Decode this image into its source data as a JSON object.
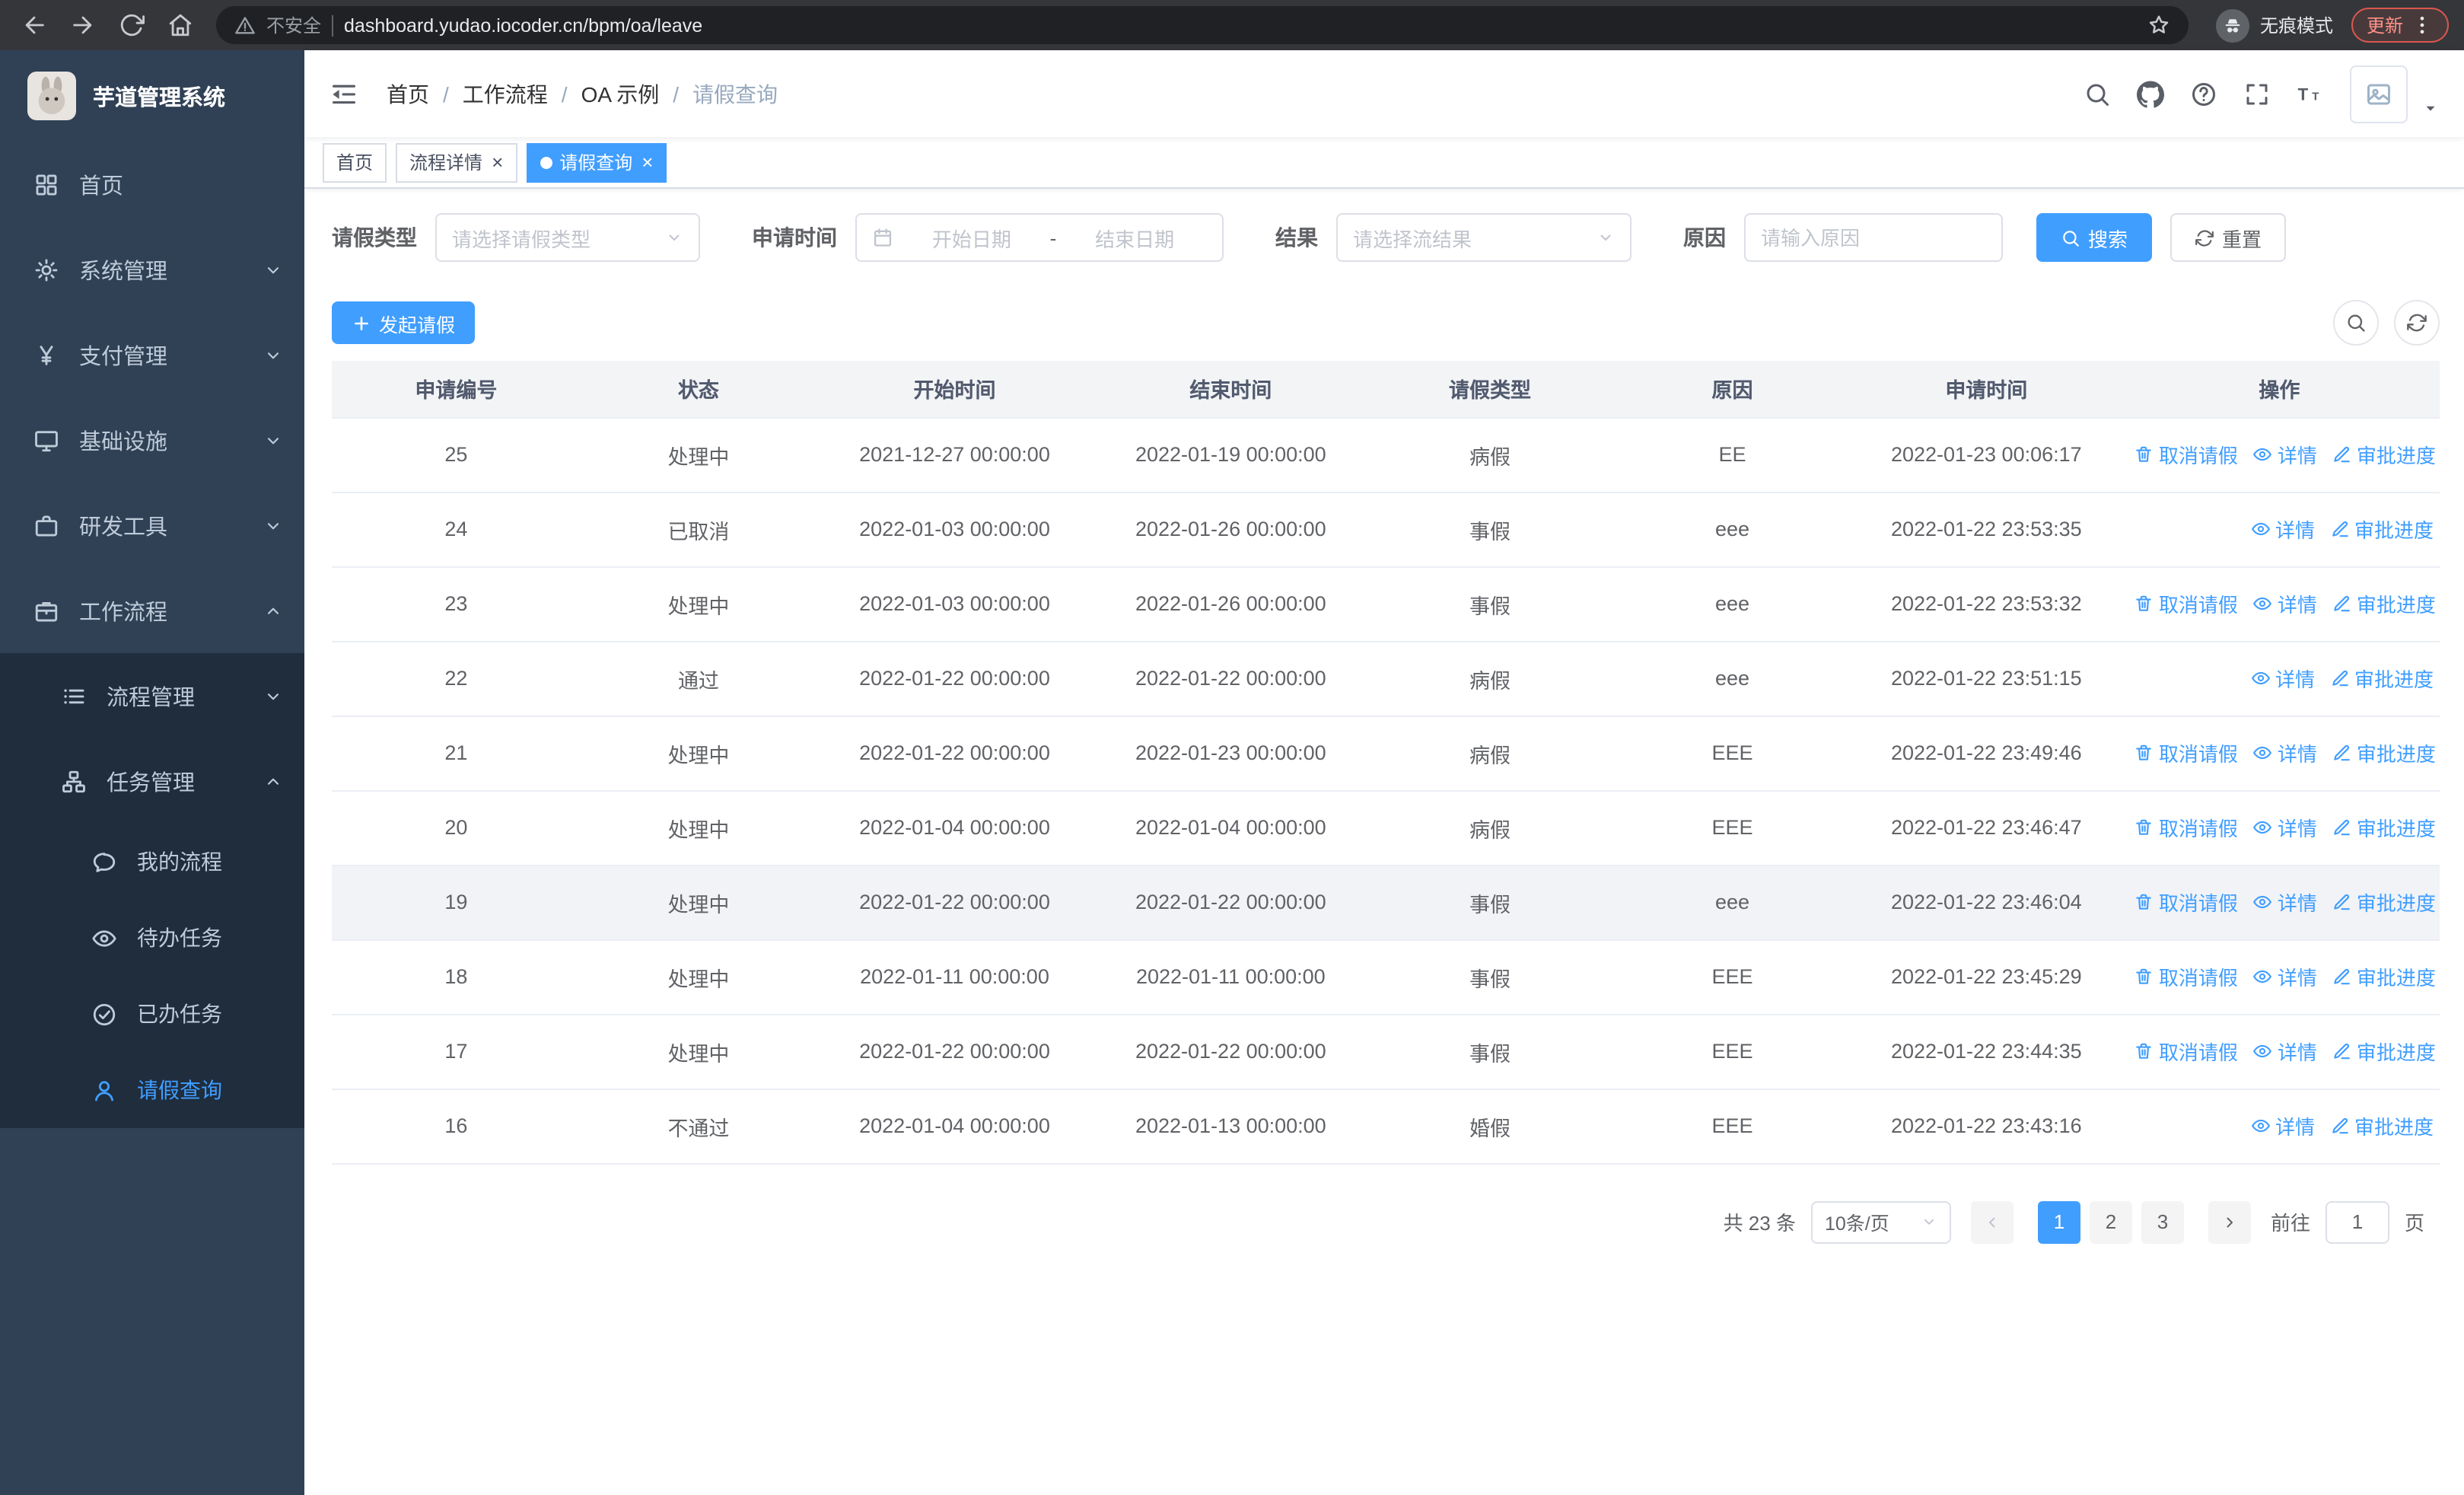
{
  "browser": {
    "security_label": "不安全",
    "url": "dashboard.yudao.iocoder.cn/bpm/oa/leave",
    "incognito_label": "无痕模式",
    "update_label": "更新"
  },
  "sidebar": {
    "logo_title": "芋道管理系统",
    "items": [
      {
        "id": "home",
        "label": "首页",
        "icon": "dashboard",
        "level": 1
      },
      {
        "id": "system-mgmt",
        "label": "系统管理",
        "icon": "gear",
        "level": 1,
        "chevron": "down"
      },
      {
        "id": "payment-mgmt",
        "label": "支付管理",
        "icon": "yen",
        "level": 1,
        "chevron": "down"
      },
      {
        "id": "infrastructure",
        "label": "基础设施",
        "icon": "monitor",
        "level": 1,
        "chevron": "down"
      },
      {
        "id": "dev-tools",
        "label": "研发工具",
        "icon": "briefcase",
        "level": 1,
        "chevron": "down"
      },
      {
        "id": "workflow",
        "label": "工作流程",
        "icon": "suitcase",
        "level": 1,
        "chevron": "up"
      },
      {
        "id": "process-mgmt",
        "label": "流程管理",
        "icon": "list",
        "level": 2,
        "chevron": "down",
        "sub": true
      },
      {
        "id": "task-mgmt",
        "label": "任务管理",
        "icon": "sitemap",
        "level": 2,
        "chevron": "up",
        "sub": true
      },
      {
        "id": "my-process",
        "label": "我的流程",
        "icon": "chat",
        "level": 3,
        "sub": true
      },
      {
        "id": "todo-tasks",
        "label": "待办任务",
        "icon": "eye",
        "level": 3,
        "sub": true
      },
      {
        "id": "done-tasks",
        "label": "已办任务",
        "icon": "check-circle",
        "level": 3,
        "sub": true
      },
      {
        "id": "leave-query",
        "label": "请假查询",
        "icon": "user",
        "level": 3,
        "sub": true,
        "active": true
      }
    ]
  },
  "header": {
    "breadcrumb": [
      "首页",
      "工作流程",
      "OA 示例",
      "请假查询"
    ],
    "breadcrumb_separator": "/"
  },
  "tabs": [
    {
      "label": "首页",
      "closable": false,
      "active": false
    },
    {
      "label": "流程详情",
      "closable": true,
      "active": false
    },
    {
      "label": "请假查询",
      "closable": true,
      "active": true
    }
  ],
  "filters": {
    "leave_type_label": "请假类型",
    "leave_type_placeholder": "请选择请假类型",
    "apply_time_label": "申请时间",
    "start_date_placeholder": "开始日期",
    "range_separator": "-",
    "end_date_placeholder": "结束日期",
    "result_label": "结果",
    "result_placeholder": "请选择流结果",
    "reason_label": "原因",
    "reason_placeholder": "请输入原因",
    "search_label": "搜索",
    "reset_label": "重置"
  },
  "toolbar": {
    "create_label": "发起请假"
  },
  "table": {
    "columns": [
      "申请编号",
      "状态",
      "开始时间",
      "结束时间",
      "请假类型",
      "原因",
      "申请时间",
      "操作"
    ],
    "action_labels": {
      "cancel": "取消请假",
      "detail": "详情",
      "progress": "审批进度"
    },
    "rows": [
      {
        "id": "25",
        "status": "处理中",
        "start": "2021-12-27 00:00:00",
        "end": "2022-01-19 00:00:00",
        "type": "病假",
        "reason": "EE",
        "applied": "2022-01-23 00:06:17",
        "actions": [
          "cancel",
          "detail",
          "progress"
        ]
      },
      {
        "id": "24",
        "status": "已取消",
        "start": "2022-01-03 00:00:00",
        "end": "2022-01-26 00:00:00",
        "type": "事假",
        "reason": "eee",
        "applied": "2022-01-22 23:53:35",
        "actions": [
          "detail",
          "progress"
        ]
      },
      {
        "id": "23",
        "status": "处理中",
        "start": "2022-01-03 00:00:00",
        "end": "2022-01-26 00:00:00",
        "type": "事假",
        "reason": "eee",
        "applied": "2022-01-22 23:53:32",
        "actions": [
          "cancel",
          "detail",
          "progress"
        ]
      },
      {
        "id": "22",
        "status": "通过",
        "start": "2022-01-22 00:00:00",
        "end": "2022-01-22 00:00:00",
        "type": "病假",
        "reason": "eee",
        "applied": "2022-01-22 23:51:15",
        "actions": [
          "detail",
          "progress"
        ]
      },
      {
        "id": "21",
        "status": "处理中",
        "start": "2022-01-22 00:00:00",
        "end": "2022-01-23 00:00:00",
        "type": "病假",
        "reason": "EEE",
        "applied": "2022-01-22 23:49:46",
        "actions": [
          "cancel",
          "detail",
          "progress"
        ]
      },
      {
        "id": "20",
        "status": "处理中",
        "start": "2022-01-04 00:00:00",
        "end": "2022-01-04 00:00:00",
        "type": "病假",
        "reason": "EEE",
        "applied": "2022-01-22 23:46:47",
        "actions": [
          "cancel",
          "detail",
          "progress"
        ]
      },
      {
        "id": "19",
        "status": "处理中",
        "start": "2022-01-22 00:00:00",
        "end": "2022-01-22 00:00:00",
        "type": "事假",
        "reason": "eee",
        "applied": "2022-01-22 23:46:04",
        "actions": [
          "cancel",
          "detail",
          "progress"
        ],
        "highlighted": true
      },
      {
        "id": "18",
        "status": "处理中",
        "start": "2022-01-11 00:00:00",
        "end": "2022-01-11 00:00:00",
        "type": "事假",
        "reason": "EEE",
        "applied": "2022-01-22 23:45:29",
        "actions": [
          "cancel",
          "detail",
          "progress"
        ]
      },
      {
        "id": "17",
        "status": "处理中",
        "start": "2022-01-22 00:00:00",
        "end": "2022-01-22 00:00:00",
        "type": "事假",
        "reason": "EEE",
        "applied": "2022-01-22 23:44:35",
        "actions": [
          "cancel",
          "detail",
          "progress"
        ]
      },
      {
        "id": "16",
        "status": "不通过",
        "start": "2022-01-04 00:00:00",
        "end": "2022-01-13 00:00:00",
        "type": "婚假",
        "reason": "EEE",
        "applied": "2022-01-22 23:43:16",
        "actions": [
          "detail",
          "progress"
        ]
      }
    ]
  },
  "pagination": {
    "total_label": "共 23 条",
    "page_size": "10条/页",
    "pages": [
      "1",
      "2",
      "3"
    ],
    "active_page": "1",
    "goto_label": "前往",
    "goto_value": "1",
    "page_suffix": "页"
  },
  "colors": {
    "primary": "#409eff",
    "sidebar_bg": "#304156",
    "sidebar_submenu_bg": "#1f2d3d"
  }
}
